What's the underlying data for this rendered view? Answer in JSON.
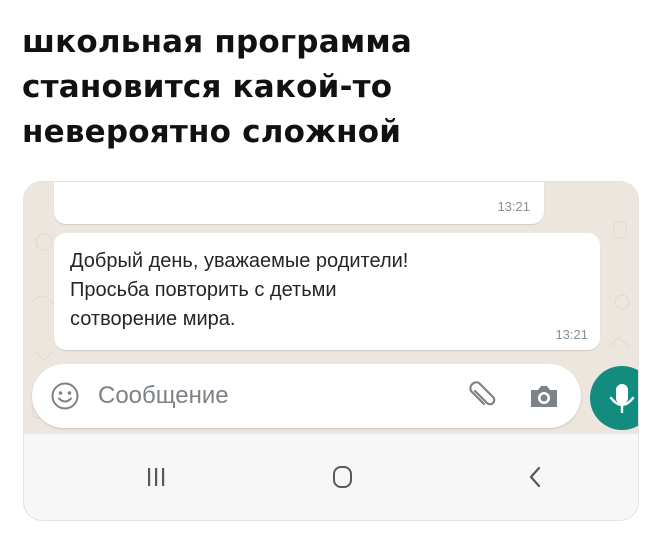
{
  "caption": {
    "lines": [
      "школьная программа",
      "становится какой-то",
      "невероятно сложной"
    ]
  },
  "chat": {
    "previous_message": {
      "time": "13:21"
    },
    "message": {
      "lines": [
        "Добрый день, уважаемые родители!",
        "Просьба повторить с детьми",
        "сотворение мира."
      ],
      "time": "13:21"
    }
  },
  "composer": {
    "placeholder": "Сообщение",
    "icons": [
      "emoji-icon",
      "paperclip-icon",
      "camera-icon",
      "microphone-icon"
    ]
  },
  "navigation": {
    "icons": [
      "recent-apps-icon",
      "home-icon",
      "back-icon"
    ]
  },
  "colors": {
    "chat_background": "#ede6df",
    "accent": "#128c7e",
    "bubble": "#ffffff",
    "timestamp": "#8a8f93"
  }
}
